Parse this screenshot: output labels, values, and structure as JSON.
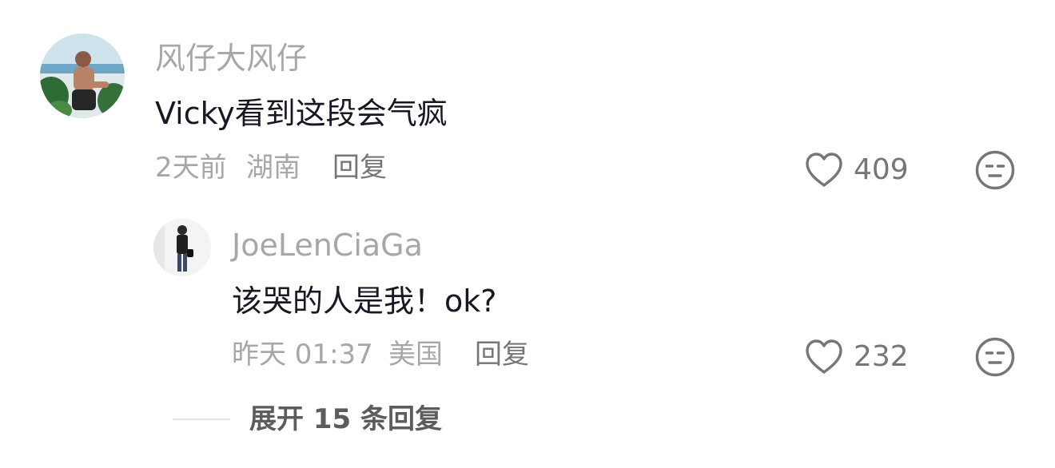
{
  "comments": [
    {
      "username": "风仔大风仔",
      "text": "Vicky看到这段会气疯",
      "time": "2天前",
      "location": "湖南",
      "reply_label": "回复",
      "likes": "409",
      "avatar": "user-photo"
    }
  ],
  "replies": [
    {
      "username": "JoeLenCiaGa",
      "text": "该哭的人是我！ok?",
      "time": "昨天 01:37",
      "location": "美国",
      "reply_label": "回复",
      "likes": "232",
      "avatar": "user-photo"
    }
  ],
  "expand": {
    "label": "展开 15 条回复"
  },
  "icons": {
    "like": "heart-outline-icon",
    "dislike": "unamused-face-icon"
  },
  "colors": {
    "username": "#a7a7ab",
    "text": "#161823",
    "meta": "#a7a7ab",
    "icon": "#75757a"
  }
}
